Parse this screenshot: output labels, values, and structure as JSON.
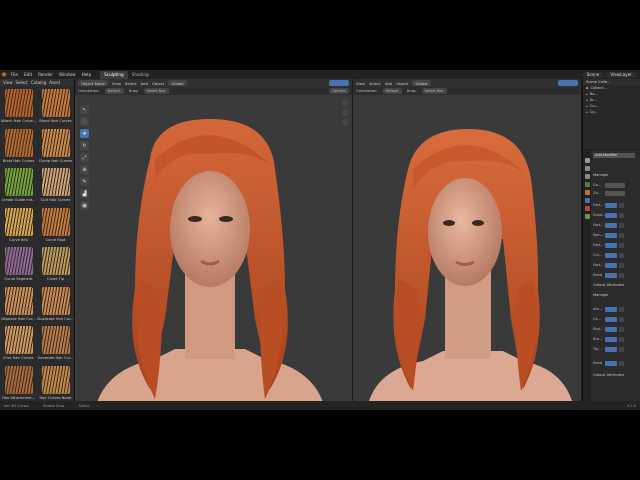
{
  "menubar": {
    "items": [
      "File",
      "Edit",
      "Render",
      "Window",
      "Help"
    ],
    "workspace_tabs": [
      {
        "label": "Sculpting",
        "active": true
      },
      {
        "label": "Shading",
        "active": false
      }
    ],
    "scene": "Scene",
    "view_layer": "ViewLayer"
  },
  "asset_panel": {
    "header": [
      "View",
      "Select",
      "Catalog",
      "Asset"
    ],
    "assets": [
      {
        "label": "Attach Hair Curve...",
        "color": "#b7632b"
      },
      {
        "label": "Blend Hair Curves",
        "color": "#c47a3a"
      },
      {
        "label": "Braid Hair Curves",
        "color": "#b56a30"
      },
      {
        "label": "Clump Hair Curves",
        "color": "#c98a4a"
      },
      {
        "label": "Create Guide Ind...",
        "color": "#6fa83a"
      },
      {
        "label": "Curl Hair Curves",
        "color": "#caa27a"
      },
      {
        "label": "Curve Info",
        "color": "#d4a84a"
      },
      {
        "label": "Curve Root",
        "color": "#c27b3b"
      },
      {
        "label": "Curve Segment",
        "color": "#8a6a9a"
      },
      {
        "label": "Curve Tip",
        "color": "#b89a5a"
      },
      {
        "label": "Displace Hair Cur...",
        "color": "#c99158"
      },
      {
        "label": "Duplicate Hair Cur...",
        "color": "#c88a55"
      },
      {
        "label": "Frizz Hair Curves",
        "color": "#cf9a60"
      },
      {
        "label": "Generate Hair Cur...",
        "color": "#b97b4b"
      },
      {
        "label": "Hair Attachment...",
        "color": "#a86a3a"
      },
      {
        "label": "Hair Curves Noise",
        "color": "#c0894a"
      }
    ]
  },
  "viewport_left": {
    "header": [
      "View",
      "Select",
      "Add",
      "Object"
    ],
    "mode": "Object Mode",
    "transform": "Global",
    "orientation_label": "Orientation:",
    "orientation_value": "Default",
    "drag_label": "Drag:",
    "drag_value": "Select Box",
    "options": "Options"
  },
  "viewport_right": {
    "header": [
      "View",
      "Select",
      "Add",
      "Object"
    ],
    "transform": "Global",
    "orientation_label": "Orientation:",
    "orientation_value": "Default",
    "drag_label": "Drag:",
    "drag_value": "Select Box"
  },
  "outliner": {
    "title": "Scene Colle...",
    "rows": [
      "Collecti...",
      "Bo...",
      "Ar...",
      "Cu...",
      "Cy..."
    ]
  },
  "properties": {
    "add_modifier": "Add Modifier",
    "sections": [
      "Manager",
      "Output Attributes",
      "Manager",
      "Output Attributes"
    ],
    "rows": [
      "Gu...",
      "Gu...",
      "Fact...",
      "Subd...",
      "Fact...",
      "Poin...",
      "Fact...",
      "Col...",
      "Fact...",
      "Seed",
      "Am...",
      "Co...",
      "Rad...",
      "Ste...",
      "Tip...",
      "Seed"
    ]
  },
  "statusbar": {
    "left": "Set 3D Cursor",
    "mid": "Rotate View",
    "right": "Select",
    "version": "4.2.0"
  },
  "colors": {
    "accent": "#4772b3",
    "hair": "#c4552a",
    "skin": "#d9a287",
    "viewport_bg": "#3a3a3a"
  }
}
